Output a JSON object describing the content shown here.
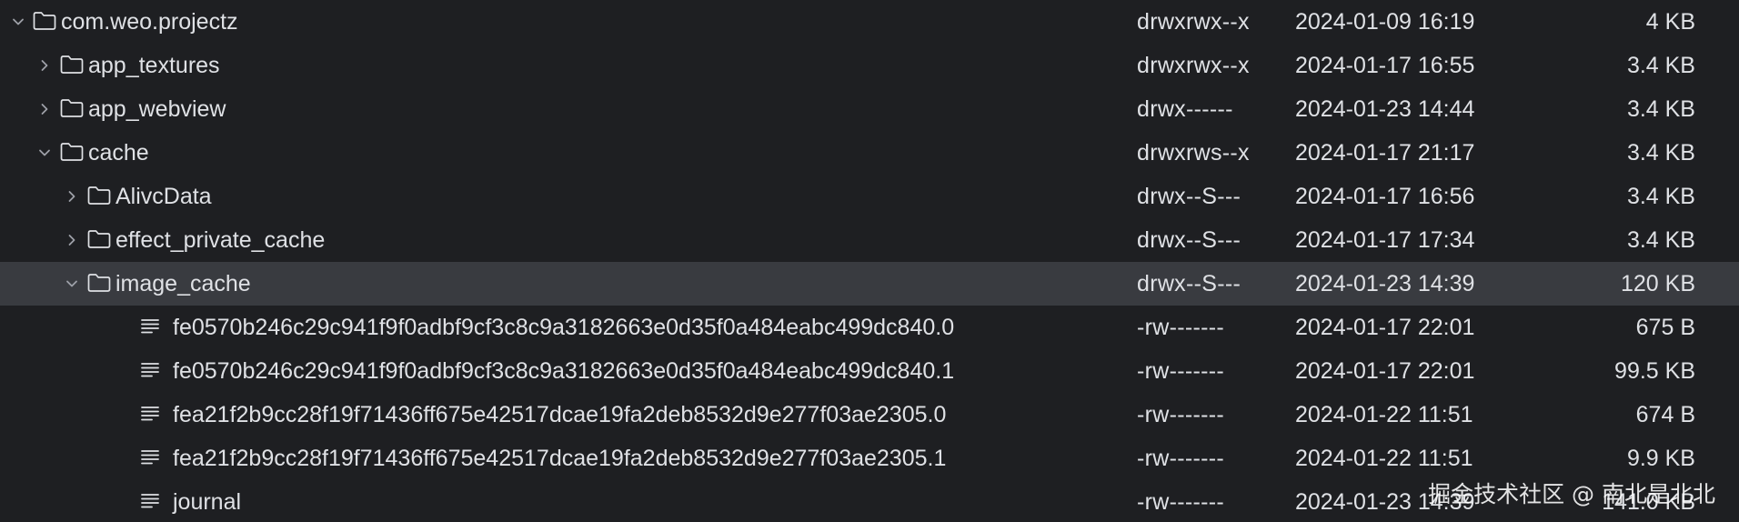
{
  "rows": [
    {
      "name": "com.weo.projectz",
      "perm": "drwxrwx--x",
      "date": "2024-01-09 16:19",
      "size": "4 KB"
    },
    {
      "name": "app_textures",
      "perm": "drwxrwx--x",
      "date": "2024-01-17 16:55",
      "size": "3.4 KB"
    },
    {
      "name": "app_webview",
      "perm": "drwx------",
      "date": "2024-01-23 14:44",
      "size": "3.4 KB"
    },
    {
      "name": "cache",
      "perm": "drwxrws--x",
      "date": "2024-01-17 21:17",
      "size": "3.4 KB"
    },
    {
      "name": "AlivcData",
      "perm": "drwx--S---",
      "date": "2024-01-17 16:56",
      "size": "3.4 KB"
    },
    {
      "name": "effect_private_cache",
      "perm": "drwx--S---",
      "date": "2024-01-17 17:34",
      "size": "3.4 KB"
    },
    {
      "name": "image_cache",
      "perm": "drwx--S---",
      "date": "2024-01-23 14:39",
      "size": "120 KB"
    },
    {
      "name": "fe0570b246c29c941f9f0adbf9cf3c8c9a3182663e0d35f0a484eabc499dc840.0",
      "perm": "-rw-------",
      "date": "2024-01-17 22:01",
      "size": "675 B"
    },
    {
      "name": "fe0570b246c29c941f9f0adbf9cf3c8c9a3182663e0d35f0a484eabc499dc840.1",
      "perm": "-rw-------",
      "date": "2024-01-17 22:01",
      "size": "99.5 KB"
    },
    {
      "name": "fea21f2b9cc28f19f71436ff675e42517dcae19fa2deb8532d9e277f03ae2305.0",
      "perm": "-rw-------",
      "date": "2024-01-22 11:51",
      "size": "674 B"
    },
    {
      "name": "fea21f2b9cc28f19f71436ff675e42517dcae19fa2deb8532d9e277f03ae2305.1",
      "perm": "-rw-------",
      "date": "2024-01-22 11:51",
      "size": "9.9 KB"
    },
    {
      "name": "journal",
      "perm": "-rw-------",
      "date": "2024-01-23 14:39",
      "size": "141.0 KB"
    }
  ],
  "watermark": "掘金技术社区 @ 南北是北北",
  "colors": {
    "background": "#1e1f22",
    "selected_row": "#393b40",
    "text": "#dfe1e5",
    "chevron": "#9da0a8"
  },
  "icons": {
    "expanded": "chevron-down-icon",
    "collapsed": "chevron-right-icon",
    "folder": "folder-icon",
    "file": "text-file-icon"
  }
}
